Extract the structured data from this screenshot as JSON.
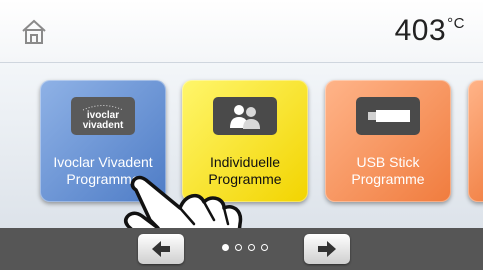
{
  "header": {
    "temperature": "403",
    "unit": "°C",
    "home_icon": "home-icon"
  },
  "tiles": [
    {
      "label_line1": "Ivoclar Vivadent",
      "label_line2": "Programme",
      "icon": "ivoclar-logo-icon",
      "logo_text": "ivoclar vivadent",
      "color": "#4e7cc6"
    },
    {
      "label_line1": "Individuelle",
      "label_line2": "Programme",
      "icon": "users-icon",
      "color": "#f2d400"
    },
    {
      "label_line1": "USB Stick",
      "label_line2": "Programme",
      "icon": "usb-stick-icon",
      "color": "#f07c3e"
    }
  ],
  "pagination": {
    "current": 1,
    "total": 4
  },
  "nav": {
    "prev_icon": "arrow-left-icon",
    "next_icon": "arrow-right-icon"
  }
}
